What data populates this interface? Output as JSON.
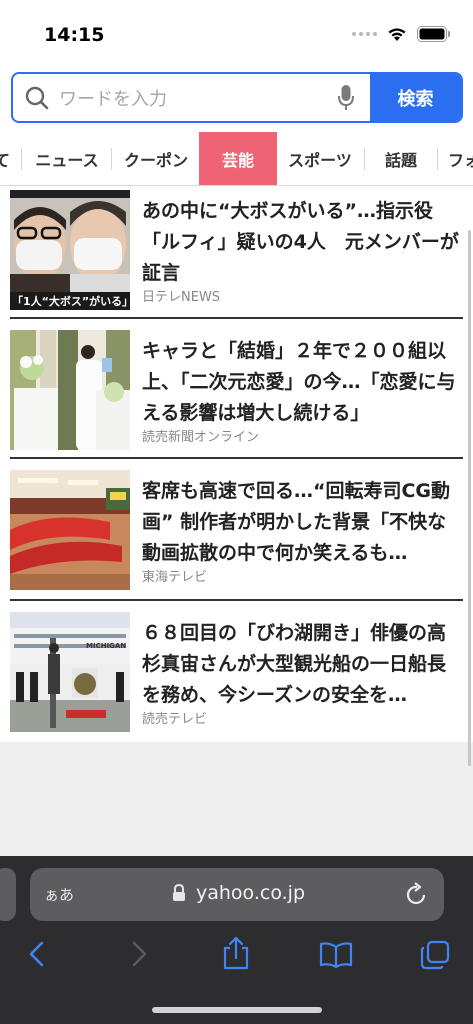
{
  "status_bar": {
    "time": "14:15"
  },
  "search": {
    "placeholder": "ワードを入力",
    "button_label": "検索"
  },
  "tabs": [
    {
      "label": "て"
    },
    {
      "label": "ニュース"
    },
    {
      "label": "クーポン"
    },
    {
      "label": "芸能",
      "active": true
    },
    {
      "label": "スポーツ"
    },
    {
      "label": "話題"
    },
    {
      "label": "フォ"
    }
  ],
  "articles": [
    {
      "title": "あの中に“大ボスがいる”…指示役「ルフィ」疑いの4人　元メンバーが証言",
      "source": "日テレNEWS",
      "thumb_caption": "「1人“大ボス”がいる」"
    },
    {
      "title": "キャラと「結婚」２年で２００組以上、「二次元恋愛」の今…「恋愛に与える影響は増大し続ける」",
      "source": "読売新聞オンライン"
    },
    {
      "title": "客席も高速で回る…“回転寿司CG動画” 制作者が明かした背景「不快な動画拡散の中で何か笑えるも…",
      "source": "東海テレビ"
    },
    {
      "title": "６８回目の「びわ湖開き」俳優の高杉真宙さんが大型観光船の一日船長を務め、今シーズンの安全を…",
      "source": "読売テレビ",
      "thumb_caption": "MICHIGAN"
    }
  ],
  "browser": {
    "text_size_label": "ぁあ",
    "url": "yahoo.co.jp"
  },
  "colors": {
    "accent": "#2b6ff0",
    "active_tab": "#ee6474",
    "toolbar": "#2d2d2f",
    "toolbar_icon": "#3f85f7"
  }
}
